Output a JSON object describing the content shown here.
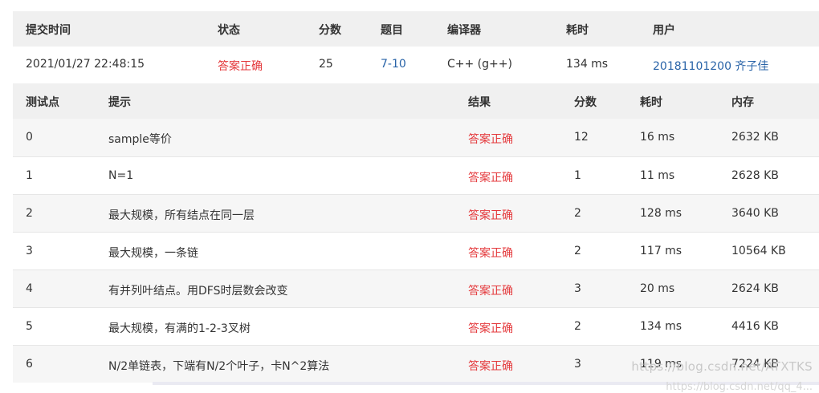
{
  "submission": {
    "headers": {
      "time": "提交时间",
      "status": "状态",
      "score": "分数",
      "problem": "题目",
      "compiler": "编译器",
      "elapsed": "耗时",
      "user": "用户"
    },
    "row": {
      "time": "2021/01/27 22:48:15",
      "status": "答案正确",
      "score": "25",
      "problem": "7-10",
      "compiler": "C++ (g++)",
      "elapsed": "134 ms",
      "user": "20181101200 齐子佳"
    },
    "colors": {
      "accepted": "#e4393c",
      "link": "#2a64a8",
      "header_bg": "#f0f0f0"
    }
  },
  "tests": {
    "headers": {
      "case": "测试点",
      "hint": "提示",
      "result": "结果",
      "score": "分数",
      "elapsed": "耗时",
      "memory": "内存"
    },
    "rows": [
      {
        "case": "0",
        "hint": "sample等价",
        "result": "答案正确",
        "score": "12",
        "elapsed": "16 ms",
        "memory": "2632 KB"
      },
      {
        "case": "1",
        "hint": "N=1",
        "result": "答案正确",
        "score": "1",
        "elapsed": "11 ms",
        "memory": "2628 KB"
      },
      {
        "case": "2",
        "hint": "最大规模，所有结点在同一层",
        "result": "答案正确",
        "score": "2",
        "elapsed": "128 ms",
        "memory": "3640 KB"
      },
      {
        "case": "3",
        "hint": "最大规模，一条链",
        "result": "答案正确",
        "score": "2",
        "elapsed": "117 ms",
        "memory": "10564 KB"
      },
      {
        "case": "4",
        "hint": "有并列叶结点。用DFS时层数会改变",
        "result": "答案正确",
        "score": "3",
        "elapsed": "20 ms",
        "memory": "2624 KB"
      },
      {
        "case": "5",
        "hint": "最大规模，有满的1-2-3叉树",
        "result": "答案正确",
        "score": "2",
        "elapsed": "134 ms",
        "memory": "4416 KB"
      },
      {
        "case": "6",
        "hint": "N/2单链表，下端有N/2个叶子，卡N^2算法",
        "result": "答案正确",
        "score": "3",
        "elapsed": "119 ms",
        "memory": "7224 KB"
      }
    ]
  },
  "watermark": {
    "line1": "https://blog.csdn.net/ATXTKS",
    "line2": "https://blog.csdn.net/qq_4..."
  }
}
